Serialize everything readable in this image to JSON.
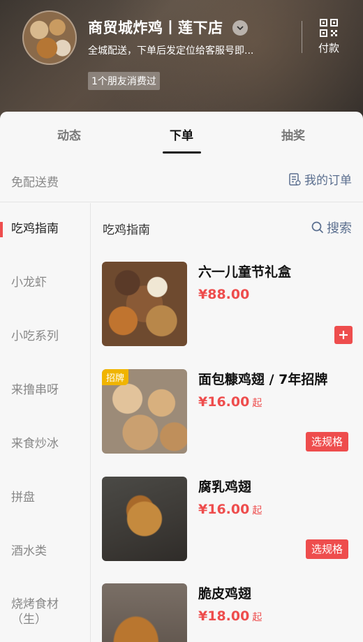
{
  "header": {
    "store_name": "商贸城炸鸡丨莲下店",
    "description": "全城配送，下单后发定位给客服号即...",
    "pay_label": "付款",
    "friend_tag": "1个朋友消费过"
  },
  "tabs": [
    {
      "label": "动态",
      "active": false
    },
    {
      "label": "下单",
      "active": true
    },
    {
      "label": "抽奖",
      "active": false
    }
  ],
  "info": {
    "free_delivery": "免配送费",
    "my_orders": "我的订单"
  },
  "categories": [
    {
      "label": "吃鸡指南",
      "active": true
    },
    {
      "label": "小龙虾"
    },
    {
      "label": "小吃系列"
    },
    {
      "label": "来撸串呀"
    },
    {
      "label": "来食炒冰"
    },
    {
      "label": "拼盘"
    },
    {
      "label": "酒水类"
    },
    {
      "label": "烧烤食材（生）"
    }
  ],
  "list": {
    "title": "吃鸡指南",
    "search_label": "搜索"
  },
  "products": [
    {
      "name": "六一儿童节礼盒",
      "price": "¥88.00",
      "price_suffix": "",
      "action": "add",
      "badge": ""
    },
    {
      "name": "面包糠鸡翅 / 7年招牌",
      "price": "¥16.00",
      "price_suffix": "起",
      "action": "选规格",
      "badge": "招牌"
    },
    {
      "name": "腐乳鸡翅",
      "price": "¥16.00",
      "price_suffix": "起",
      "action": "选规格",
      "badge": ""
    },
    {
      "name": "脆皮鸡翅",
      "price": "¥18.00",
      "price_suffix": "起",
      "action": "",
      "badge": ""
    }
  ],
  "colors": {
    "accent": "#ee4d4d",
    "link": "#5b6f8f",
    "badge": "#f0b400"
  }
}
